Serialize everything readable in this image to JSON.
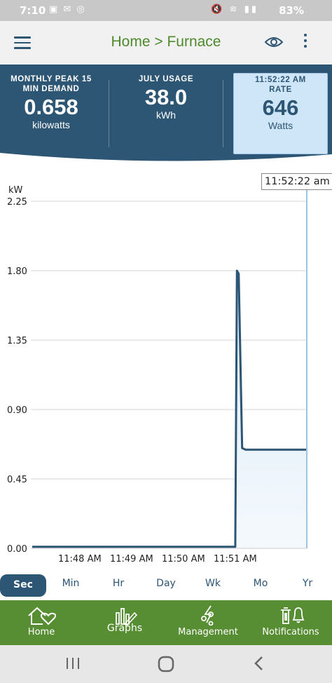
{
  "status_bar": {
    "time": "7:10",
    "battery": "83%",
    "left_icons": "▣ ✉ ◎",
    "right_icons": "🔇 ≋ ▮▮"
  },
  "app_bar": {
    "title": "Home > Furnace",
    "menu_icon": "hamburger-icon",
    "view_icon": "eye-icon",
    "more_icon": "more-vert-icon"
  },
  "stats": [
    {
      "label": "MONTHLY PEAK 15 MIN DEMAND",
      "value": "0.658",
      "unit": "kilowatts"
    },
    {
      "label": "JULY USAGE",
      "value": "38.0",
      "unit": "kWh"
    },
    {
      "label": "11:52:22 AM RATE",
      "value": "646",
      "unit": "Watts"
    }
  ],
  "colors": {
    "brand_blue": "#2d5574",
    "brand_green": "#578d33",
    "title_green": "#4e8a2c",
    "highlight": "#cfe6f8"
  },
  "chart_data": {
    "type": "area",
    "ylabel": "kW",
    "yticks": [
      "2.25",
      "1.80",
      "1.35",
      "0.90",
      "0.45",
      "0.00"
    ],
    "ylim": [
      0,
      2.25
    ],
    "xticks": [
      "11:48 AM",
      "11:49 AM",
      "11:50 AM",
      "11:51 AM"
    ],
    "cursor_time": "11:52:22 am",
    "series": [
      {
        "x": [
          "11:47:05",
          "11:47:30",
          "11:48:00",
          "11:48:30",
          "11:49:00",
          "11:49:30",
          "11:50:00",
          "11:50:30",
          "11:51:00",
          "11:51:02",
          "11:51:04",
          "11:51:08",
          "11:51:12",
          "11:51:30",
          "11:52:00",
          "11:52:22"
        ],
        "y": [
          0.01,
          0.01,
          0.01,
          0.01,
          0.01,
          0.01,
          0.01,
          0.01,
          0.01,
          1.8,
          1.78,
          0.65,
          0.64,
          0.64,
          0.64,
          0.64
        ]
      }
    ],
    "grid": true
  },
  "periods": {
    "items": [
      "Sec",
      "Min",
      "Hr",
      "Day",
      "Wk",
      "Mo",
      "Yr"
    ],
    "active": "Sec"
  },
  "bottom_nav": [
    {
      "label": "Home",
      "icon": "home-heart-icon"
    },
    {
      "label": "Graphs",
      "icon": "graphs-icon"
    },
    {
      "label": "Management",
      "icon": "management-icon"
    },
    {
      "label": "Notifications",
      "icon": "notifications-icon"
    }
  ]
}
